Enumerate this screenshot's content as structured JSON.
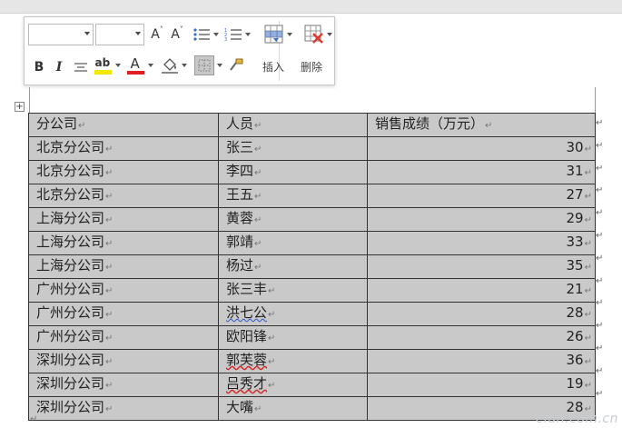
{
  "toolbar": {
    "grow_font_icon": "A",
    "shrink_font_icon": "A",
    "bold": "B",
    "italic": "I",
    "font_color_glyph": "A",
    "highlight_glyph": "ab",
    "insert_label": "插入",
    "delete_label": "删除",
    "colors": {
      "highlight": "#f5e600",
      "font_color": "#e02020",
      "delete_x": "#e03a2f",
      "grid_blue": "#3b6fc7"
    }
  },
  "table": {
    "headers": [
      "分公司",
      "人员",
      "销售成绩（万元）"
    ],
    "rows": [
      [
        "北京分公司",
        "张三",
        "30"
      ],
      [
        "北京分公司",
        "李四",
        "31"
      ],
      [
        "北京分公司",
        "王五",
        "27"
      ],
      [
        "上海分公司",
        "黄蓉",
        "29"
      ],
      [
        "上海分公司",
        "郭靖",
        "33"
      ],
      [
        "上海分公司",
        "杨过",
        "35"
      ],
      [
        "广州分公司",
        "张三丰",
        "21"
      ],
      [
        "广州分公司",
        "洪七公",
        "28"
      ],
      [
        "广州分公司",
        "欧阳锋",
        "26"
      ],
      [
        "深圳分公司",
        "郭芙蓉",
        "36"
      ],
      [
        "深圳分公司",
        "吕秀才",
        "19"
      ],
      [
        "深圳分公司",
        "大嘴",
        "28"
      ]
    ]
  },
  "paragraph_mark": "↵",
  "watermark": "cfan.com.cn"
}
